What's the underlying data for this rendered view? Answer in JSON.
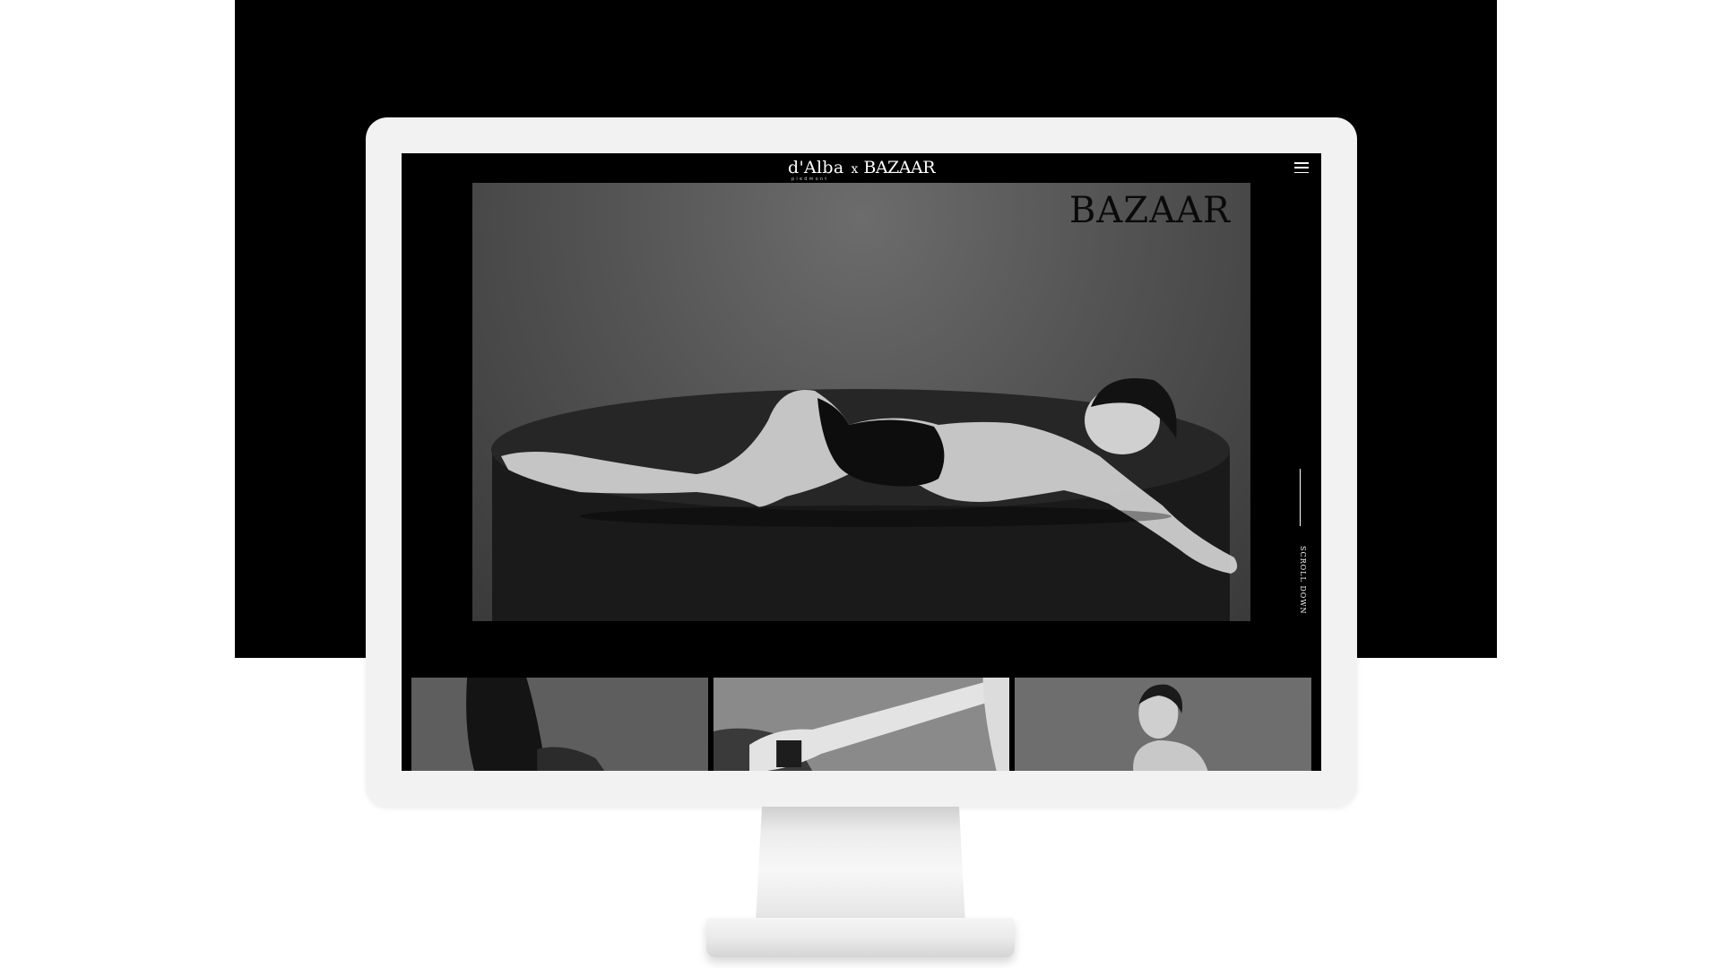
{
  "header": {
    "logo_brand": "d'Alba",
    "logo_sub": "piedmont",
    "logo_separator": "x",
    "logo_partner": "BAZAAR",
    "menu_icon": "hamburger-menu-icon"
  },
  "hero": {
    "brand_mark": "BAZAAR"
  },
  "scroll": {
    "label": "SCROLL DOWN"
  },
  "thumbnails": [
    {
      "label": "photo-hair-back"
    },
    {
      "label": "photo-hand-product"
    },
    {
      "label": "photo-portrait"
    }
  ],
  "colors": {
    "backdrop": "#000000",
    "bezel": "#f2f2f2",
    "text": "#ffffff"
  }
}
